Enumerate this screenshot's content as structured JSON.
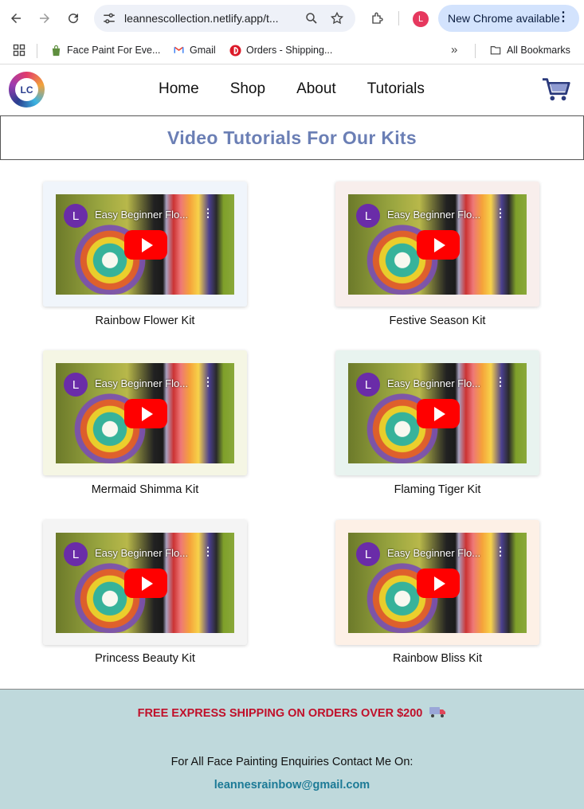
{
  "browser": {
    "url": "leannescollection.netlify.app/t...",
    "update_button": "New Chrome available",
    "profile_initial": "L",
    "bookmarks": [
      {
        "label": "Face Paint For Eve..."
      },
      {
        "label": "Gmail"
      },
      {
        "label": "Orders - Shipping..."
      }
    ],
    "all_bookmarks": "All Bookmarks"
  },
  "site": {
    "logo_text": "LC",
    "nav": [
      "Home",
      "Shop",
      "About",
      "Tutorials"
    ],
    "page_title": "Video Tutorials For Our Kits"
  },
  "videos": {
    "channel_initial": "L",
    "video_title": "Easy Beginner Flo...",
    "kits": [
      {
        "label": "Rainbow Flower Kit",
        "bg": "#f0f5fb"
      },
      {
        "label": "Festive Season Kit",
        "bg": "#f8eeec"
      },
      {
        "label": "Mermaid Shimma Kit",
        "bg": "#f5f6e4"
      },
      {
        "label": "Flaming Tiger Kit",
        "bg": "#e8f3ef"
      },
      {
        "label": "Princess Beauty Kit",
        "bg": "#f4f4f4"
      },
      {
        "label": "Rainbow Bliss Kit",
        "bg": "#fdf0e6"
      }
    ]
  },
  "footer": {
    "shipping": "FREE EXPRESS SHIPPING ON ORDERS OVER $200",
    "enquiries": "For All Face Painting Enquiries Contact Me On:",
    "email": "leannesrainbow@gmail.com"
  }
}
